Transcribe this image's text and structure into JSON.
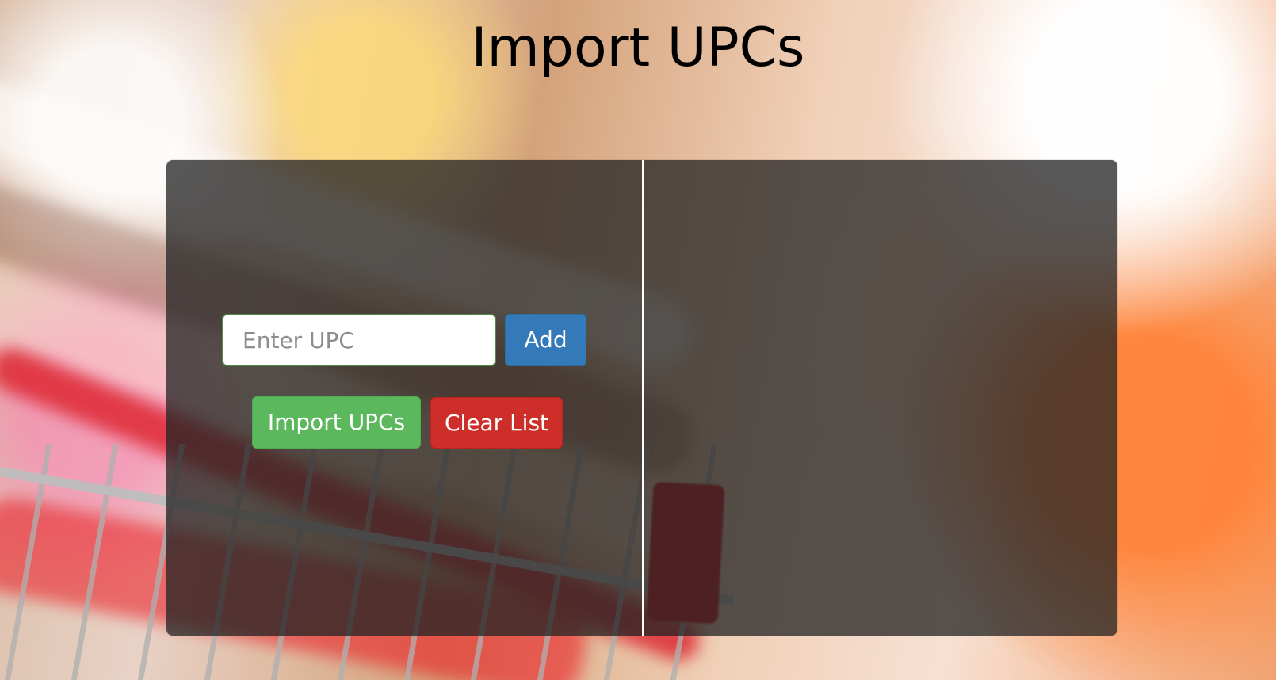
{
  "page": {
    "title": "Import UPCs"
  },
  "form": {
    "upc_input": {
      "value": "",
      "placeholder": "Enter UPC"
    },
    "buttons": {
      "add": "Add",
      "import": "Import UPCs",
      "clear": "Clear List"
    }
  },
  "colors": {
    "add_button": "#347ab8",
    "import_button": "#5cb85c",
    "clear_button": "#cd2e2a",
    "panel_overlay": "#232323",
    "divider": "#ffffff"
  }
}
